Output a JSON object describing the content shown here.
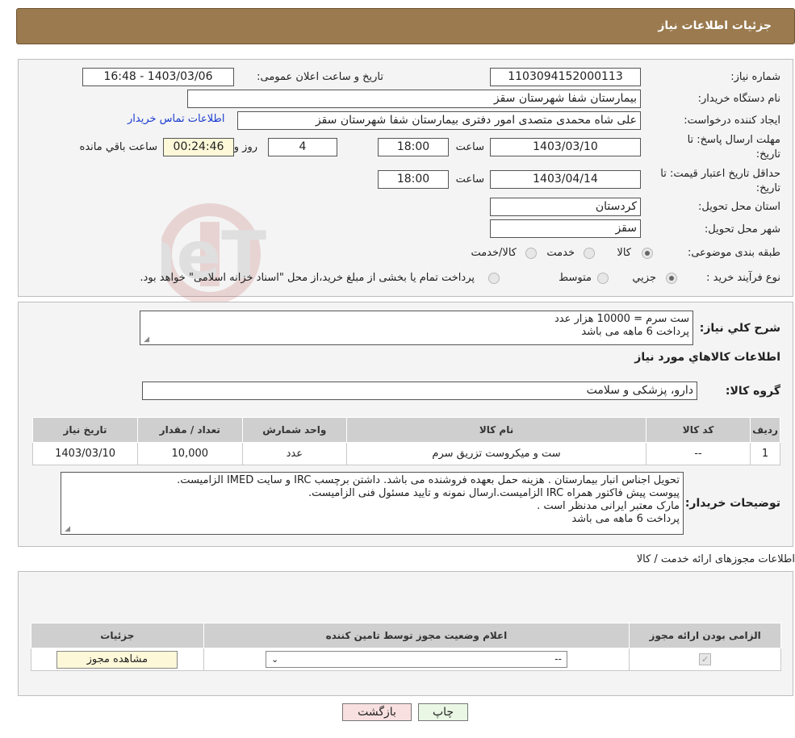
{
  "header": {
    "title": "جزئیات اطلاعات نیاز"
  },
  "watermark": {
    "text": "AriaTender.neT"
  },
  "form": {
    "need_no_label": "شماره نیاز:",
    "need_no": "1103094152000113",
    "announce_label": "تاریخ و ساعت اعلان عمومی:",
    "announce": "1403/03/06 - 16:48",
    "buyer_label": "نام دستگاه خریدار:",
    "buyer": "بیمارستان شفا شهرستان سقز",
    "creator_label": "ایجاد کننده درخواست:",
    "creator": "علی شاه محمدی متصدی امور دفتری بیمارستان شفا شهرستان سقز",
    "contact_link": "اطلاعات تماس خریدار",
    "deadline_label_1": "مهلت ارسال پاسخ: تا",
    "deadline_label_2": "تاریخ:",
    "deadline_date": "1403/03/10",
    "time_label": "ساعت",
    "deadline_time": "18:00",
    "days": "4",
    "days_label": "روز و",
    "remaining": "00:24:46",
    "remaining_label": "ساعت باقي مانده",
    "validity_label_1": "حداقل تاریخ اعتبار قیمت: تا",
    "validity_label_2": "تاریخ:",
    "validity_date": "1403/04/14",
    "validity_time": "18:00",
    "province_label": "استان محل تحویل:",
    "province": "کردستان",
    "city_label": "شهر محل تحویل:",
    "city": "سقز",
    "category_label": "طبقه بندی موضوعی:",
    "category_options": [
      "کالا",
      "خدمت",
      "کالا/خدمت"
    ],
    "process_label": "نوع فرآیند خرید :",
    "process_options": [
      "جزیي",
      "متوسط"
    ],
    "process_note": "پرداخت تمام یا بخشی از مبلغ خرید،از محل \"اسناد خزانه اسلامی\" خواهد بود."
  },
  "summary": {
    "desc_label": "شرح کلي نياز:",
    "desc_lines": [
      "ست سرم = 10000 هزار عدد",
      "پرداخت 6 ماهه می باشد"
    ],
    "goods_title": "اطلاعات کالاهاي مورد نياز",
    "group_label": "گروه کالا:",
    "group": "دارو، پزشکی و سلامت",
    "table_headers": [
      "ردیف",
      "کد کالا",
      "نام کالا",
      "واحد شمارش",
      "تعداد / مقدار",
      "تاریخ نیاز"
    ],
    "table_row": [
      "1",
      "--",
      "ست و میکروست تزریق سرم",
      "عدد",
      "10,000",
      "1403/03/10"
    ],
    "buyer_notes_label": "توضیحات خریدار:",
    "buyer_notes": [
      "تحویل اجناس  انبار بیمارستان . هزینه حمل بعهده فروشنده می باشد.  داشتن برچسب IRC  و سایت  IMED  الزامیست.",
      "پیوست پیش فاکتور همراه IRC  الزامیست.ارسال نمونه و تایید مسئول فنی الزامیست.",
      " مارک معتبر ایرانی مدنظر است .",
      "پرداخت 6 ماهه می باشد"
    ]
  },
  "permits": {
    "title": "اطلاعات مجوزهای ارائه خدمت / کالا",
    "headers": [
      "الزامی بودن ارائه مجوز",
      "اعلام وضعیت مجوز توسط تامین کننده",
      "جزئیات"
    ],
    "select_value": "--",
    "view_button": "مشاهده مجوز"
  },
  "buttons": {
    "print": "چاپ",
    "back": "بازگشت"
  }
}
